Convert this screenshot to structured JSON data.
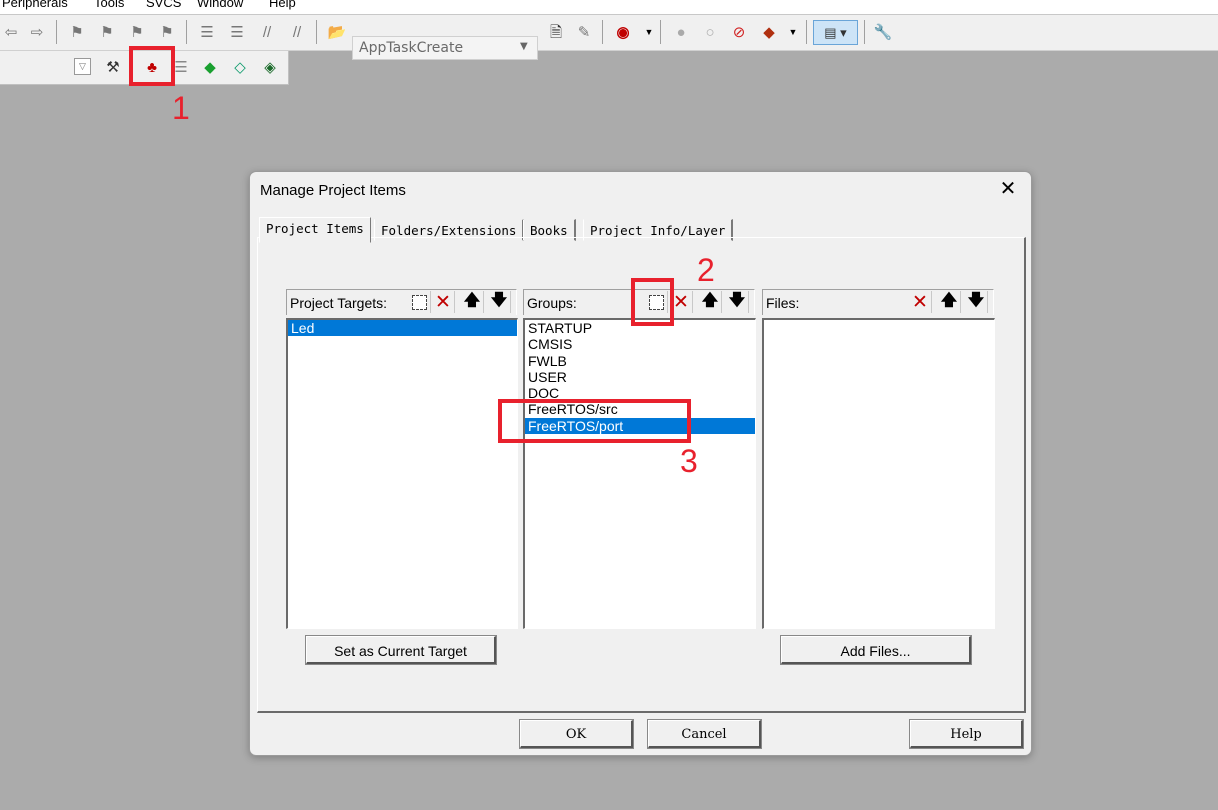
{
  "menu": [
    "Peripherals",
    "Tools",
    "SVCS",
    "Window",
    "Help"
  ],
  "toolbar": {
    "target_combo": "AppTaskCreate"
  },
  "annotations": [
    "1",
    "2",
    "3"
  ],
  "dialog": {
    "title": "Manage Project Items",
    "close_glyph": "✕",
    "tabs": [
      "Project Items",
      "Folders/Extensions",
      "Books",
      "Project Info/Layer"
    ],
    "targets": {
      "label": "Project Targets:",
      "items": [
        "Led"
      ],
      "selected": "Led",
      "button": "Set as Current Target"
    },
    "groups": {
      "label": "Groups:",
      "items": [
        "STARTUP",
        "CMSIS",
        "FWLB",
        "USER",
        "DOC",
        "FreeRTOS/src",
        "FreeRTOS/port"
      ],
      "selected": "FreeRTOS/port"
    },
    "files": {
      "label": "Files:",
      "items": [],
      "button": "Add Files..."
    },
    "ok": "OK",
    "cancel": "Cancel",
    "help": "Help"
  },
  "colors": {
    "selection": "#0078d7",
    "annotation": "#e8212d",
    "background": "#ababab"
  }
}
